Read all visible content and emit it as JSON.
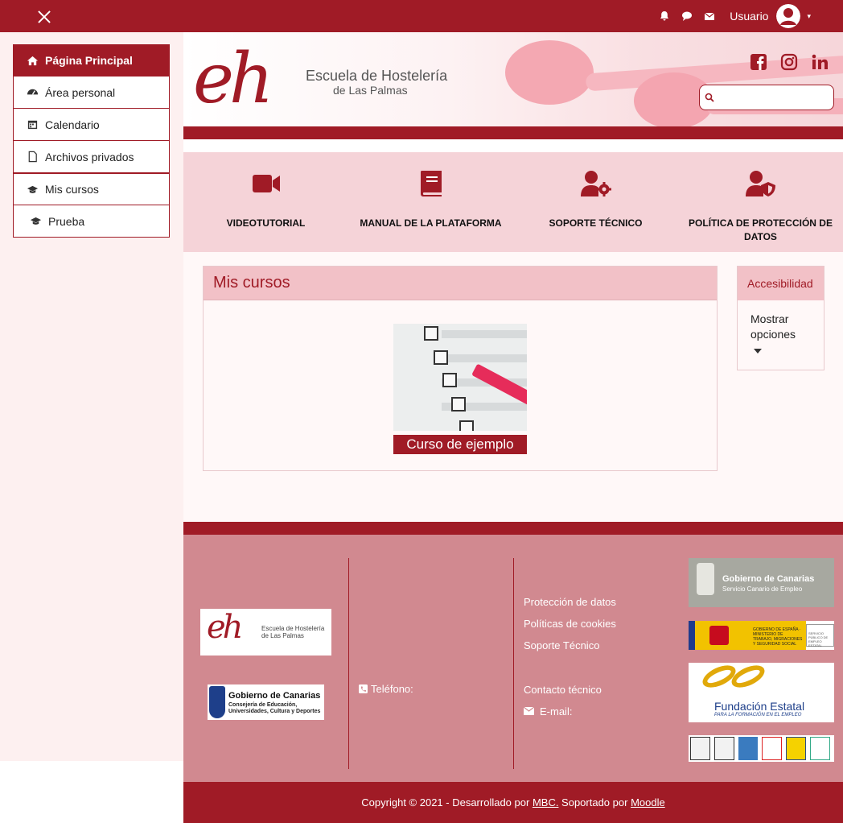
{
  "topbar": {
    "username": "Usuario",
    "icons": [
      "close-icon",
      "bell-icon",
      "chat-icon",
      "envelope-icon",
      "user-avatar-icon",
      "caret-down-icon"
    ]
  },
  "sidebar": {
    "items": [
      {
        "label": "Página Principal",
        "icon": "home-icon"
      },
      {
        "label": "Área personal",
        "icon": "dashboard-icon"
      },
      {
        "label": "Calendario",
        "icon": "calendar-icon"
      },
      {
        "label": "Archivos privados",
        "icon": "file-icon"
      },
      {
        "label": "Mis cursos",
        "icon": "graduation-cap-icon"
      },
      {
        "label": "Prueba",
        "icon": "graduation-cap-icon"
      }
    ]
  },
  "header": {
    "logo_letters": "eh",
    "logo_line1": "Escuela de Hostelería",
    "logo_line2": "de Las Palmas",
    "social_icons": [
      "facebook-icon",
      "instagram-icon",
      "linkedin-icon"
    ],
    "search_placeholder": ""
  },
  "quicklinks": [
    {
      "label": "VIDEOTUTORIAL",
      "icon": "video-icon"
    },
    {
      "label": "MANUAL DE LA PLATAFORMA",
      "icon": "book-icon"
    },
    {
      "label": "SOPORTE TÉCNICO",
      "icon": "user-gear-icon"
    },
    {
      "label": "POLÍTICA DE PROTECCIÓN DE DATOS",
      "icon": "user-shield-icon"
    }
  ],
  "main": {
    "section_title": "Mis cursos",
    "course_title": "Curso de ejemplo"
  },
  "accessibility": {
    "title": "Accesibilidad",
    "show_options": "Mostrar opciones"
  },
  "footer": {
    "logo1_letters": "eh",
    "logo1_text": "Escuela de Hostelería de Las Palmas",
    "logo2_title": "Gobierno de Canarias",
    "logo2_sub": "Consejería de Educación, Universidades, Cultura y Deportes",
    "phone_label": "Teléfono:",
    "links": [
      "Protección de datos",
      "Políticas de cookies",
      "Soporte Técnico"
    ],
    "contact_title": "Contacto técnico",
    "email_label": "E-mail:",
    "sponsor1_title": "Gobierno de Canarias",
    "sponsor1_sub": "Servicio Canario de Empleo",
    "sponsor2_text": "GOBIERNO DE ESPAÑA · MINISTERIO DE TRABAJO, MIGRACIONES Y SEGURIDAD SOCIAL",
    "sponsor2_sub": "SERVICIO PÚBLICO DE EMPLEO ESTATAL",
    "sponsor3_title": "Fundación Estatal",
    "sponsor3_sub": "PARA LA FORMACIÓN EN EL EMPLEO"
  },
  "copyright": {
    "prefix": "Copyright © 2021 - Desarrollado por ",
    "mbc": "MBC.",
    "middle": " Soportado por ",
    "moodle": "Moodle"
  },
  "colors": {
    "brand": "#a01b26",
    "sidebar_bg": "#fdf0f0",
    "quicklinks_bg": "#f5d3d8",
    "footer_bg": "#d18990"
  }
}
